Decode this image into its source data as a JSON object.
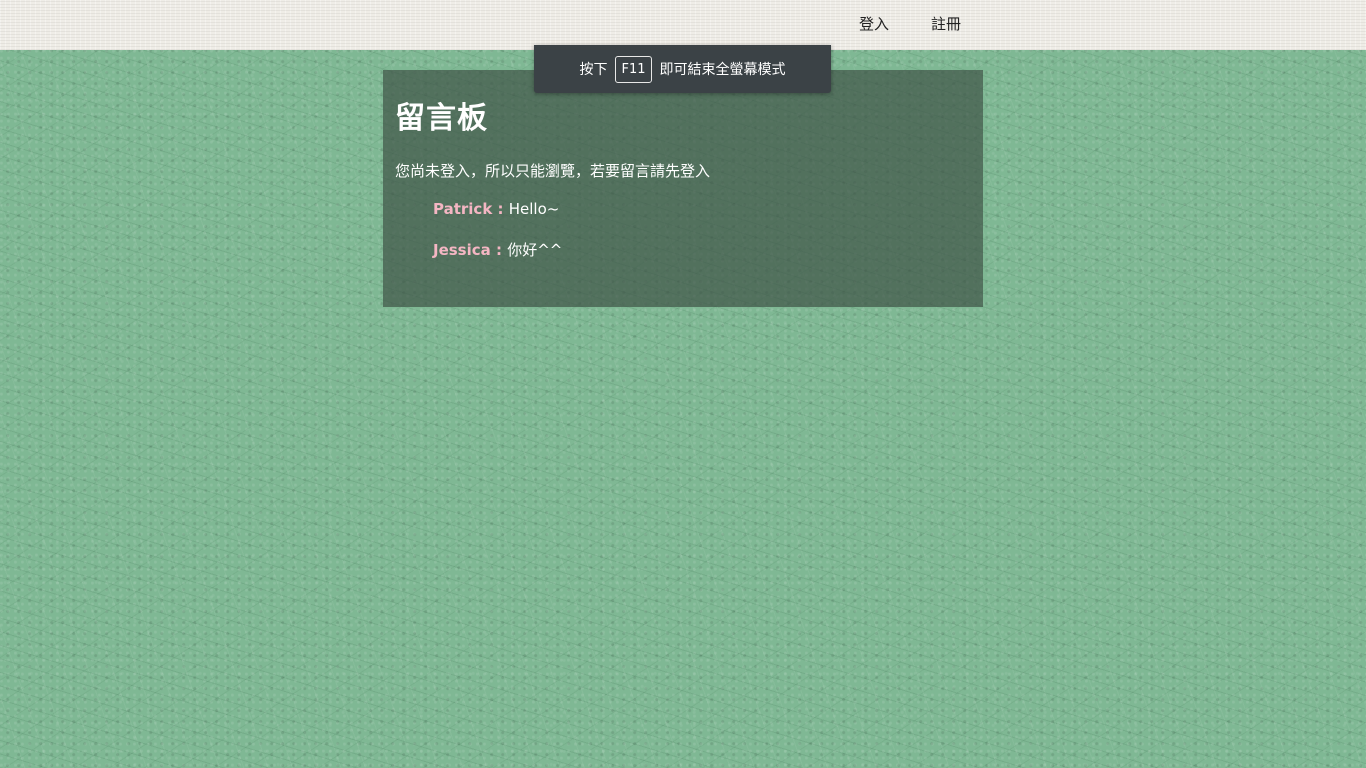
{
  "nav": {
    "login": "登入",
    "register": "註冊"
  },
  "fullscreen_toast": {
    "prefix": "按下",
    "key": "F11",
    "suffix": "即可結束全螢幕模式"
  },
  "board": {
    "title": "留言板",
    "notice": "您尚未登入，所以只能瀏覽，若要留言請先登入",
    "separator": " : ",
    "messages": [
      {
        "author": "Patrick",
        "text": "Hello~"
      },
      {
        "author": "Jessica",
        "text": "你好^^"
      }
    ]
  },
  "colors": {
    "background": "#7fb894",
    "topbar": "#efede7",
    "panel": "#3c5044",
    "author": "#f4b6c3",
    "toast": "#3b4246"
  }
}
